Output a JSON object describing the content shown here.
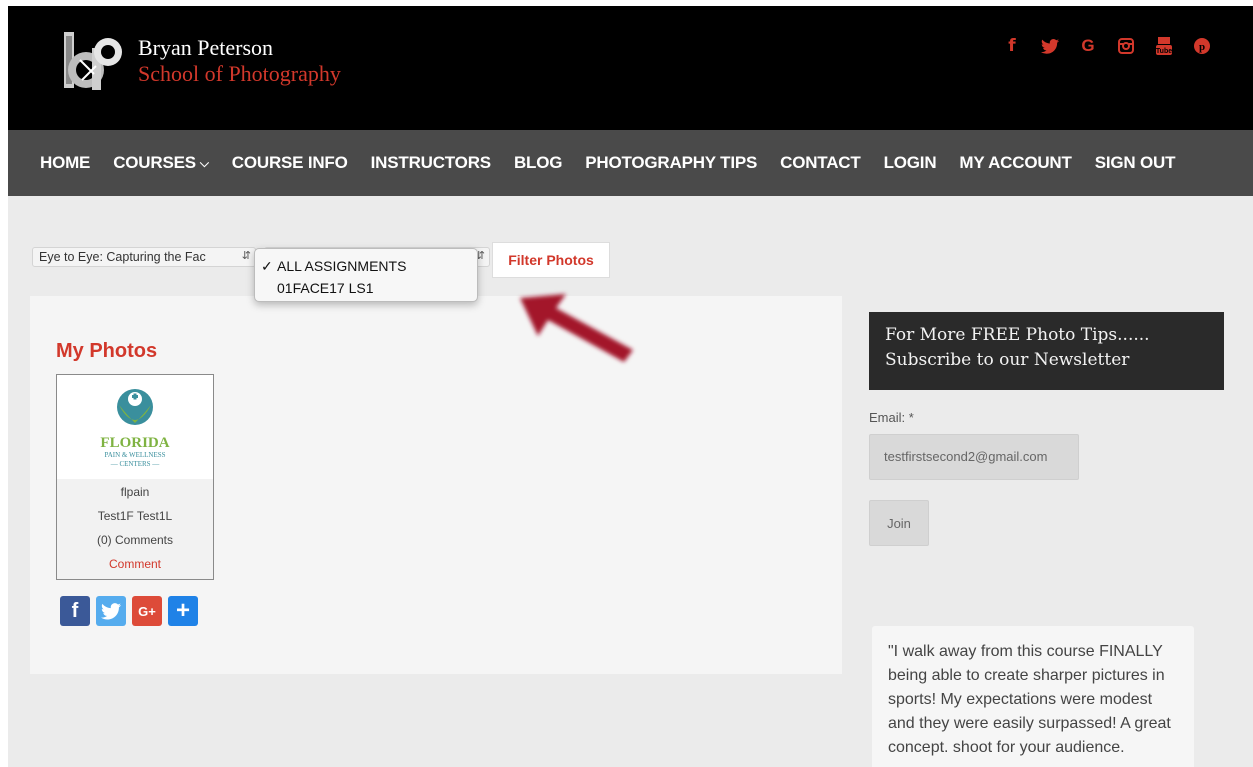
{
  "brand": {
    "line1": "Bryan Peterson",
    "line2": "School of Photography",
    "accent_color": "#d2382b"
  },
  "social": [
    {
      "icon": "facebook-icon",
      "glyph": "f"
    },
    {
      "icon": "twitter-icon",
      "glyph": "🐦"
    },
    {
      "icon": "google-icon",
      "glyph": "G"
    },
    {
      "icon": "instagram-icon",
      "glyph": "◙"
    },
    {
      "icon": "youtube-icon",
      "glyph": "▣"
    },
    {
      "icon": "pinterest-icon",
      "glyph": "℗"
    }
  ],
  "nav": {
    "home": "HOME",
    "courses": "COURSES",
    "course_info": "COURSE INFO",
    "instructors": "INSTRUCTORS",
    "blog": "BLOG",
    "photography_tips": "PHOTOGRAPHY TIPS",
    "contact": "CONTACT",
    "login": "LOGIN",
    "my_account": "MY ACCOUNT",
    "sign_out": "SIGN OUT"
  },
  "filters": {
    "course_select_value": "Eye to Eye: Capturing the Fac",
    "assignment_options": [
      "ALL ASSIGNMENTS",
      "01FACE17 LS1"
    ],
    "assignment_selected_index": 0,
    "filter_button": "Filter Photos"
  },
  "main": {
    "title": "My Photos",
    "photo": {
      "logo_line1": "FLORIDA",
      "logo_line2": "PAIN & WELLNESS",
      "logo_line3": "— CENTERS —",
      "name": "flpain",
      "author": "Test1F Test1L",
      "comments": "(0) Comments",
      "comment_link": "Comment"
    },
    "share": [
      {
        "icon": "facebook-share-icon",
        "glyph": "f",
        "color": "#3b5998"
      },
      {
        "icon": "twitter-share-icon",
        "glyph": "🐦",
        "color": "#55acee"
      },
      {
        "icon": "googleplus-share-icon",
        "glyph": "G+",
        "color": "#dd4b39"
      },
      {
        "icon": "addthis-share-icon",
        "glyph": "+",
        "color": "#1f82e7"
      }
    ]
  },
  "sidebar": {
    "newsletter_line1": "For More FREE Photo Tips......",
    "newsletter_line2": "Subscribe to our Newsletter",
    "email_label": "Email: *",
    "email_value": "testfirstsecond2@gmail.com",
    "join_button": "Join",
    "quote": "\"I walk away from this course FINALLY being able to create sharper pictures in sports! My expectations were modest and they were easily surpassed! A great concept. shoot for your audience."
  }
}
